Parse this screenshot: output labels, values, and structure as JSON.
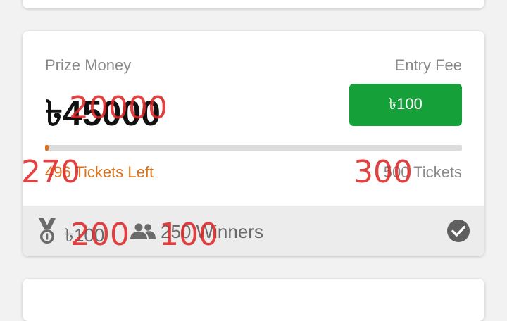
{
  "card": {
    "prize_label": "Prize Money",
    "prize_amount": "৳45000",
    "entry_label": "Entry Fee",
    "entry_fee": "৳100",
    "tickets_left": "496 Tickets Left",
    "tickets_total": "500 Tickets",
    "progress_fraction": 0.008,
    "first_prize": "৳100",
    "winners": "250 Winners"
  },
  "overlay": {
    "prize_value": "20000",
    "left_value": "270",
    "total_value": "300",
    "first_prize_value": "200",
    "winners_value": "100"
  },
  "colors": {
    "accent": "#15a03a",
    "progress": "#e0701a",
    "overlay": "#e02828"
  },
  "icons": {
    "medal": "medal-icon",
    "people": "people-icon",
    "check": "check-circle-icon"
  }
}
